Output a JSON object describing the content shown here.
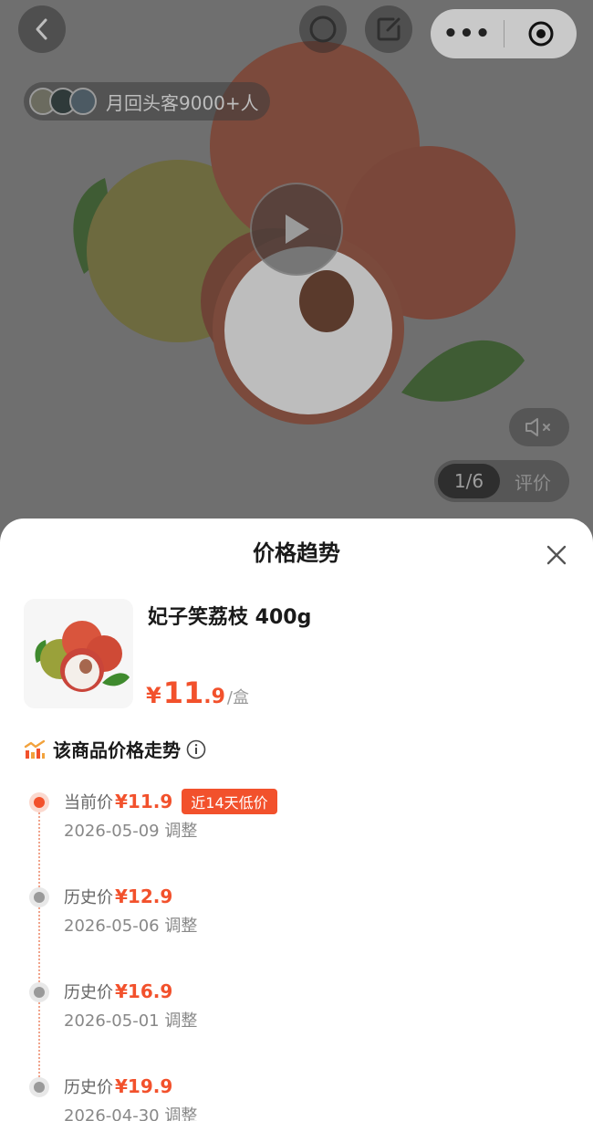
{
  "header": {
    "capsule_more": "•••"
  },
  "repurchase": {
    "text": "月回头客9000+人"
  },
  "pager": {
    "count": "1/6",
    "review": "评价"
  },
  "sheet": {
    "title": "价格趋势"
  },
  "product": {
    "name": "妃子笑荔枝 400g",
    "price_symbol": "¥",
    "price_int": "11",
    "price_dec": ".9",
    "unit": "/盒"
  },
  "trend": {
    "title": "该商品价格走势",
    "items": [
      {
        "label": "当前价",
        "price": "¥11.9",
        "badge": "近14天低价",
        "date": "2026-05-09 调整",
        "current": true
      },
      {
        "label": "历史价",
        "price": "¥12.9",
        "date": "2026-05-06 调整",
        "current": false
      },
      {
        "label": "历史价",
        "price": "¥16.9",
        "date": "2026-05-01 调整",
        "current": false
      },
      {
        "label": "历史价",
        "price": "¥19.9",
        "date": "2026-04-30 调整",
        "current": false
      }
    ]
  },
  "colors": {
    "accent": "#f2512c",
    "overlay": "#6f6f6f"
  }
}
